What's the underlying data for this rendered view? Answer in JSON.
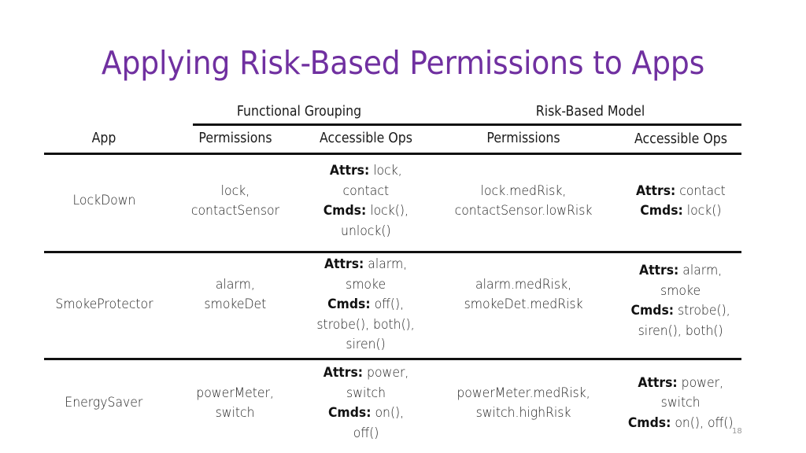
{
  "slide": {
    "title": "Applying Risk-Based Permissions to Apps",
    "page_number": "18",
    "title_color": "#7030a0"
  },
  "table": {
    "group_headers": {
      "functional": "Functional Grouping",
      "risk": "Risk-Based Model"
    },
    "columns": {
      "app": "App",
      "fg_permissions": "Permissions",
      "fg_ops": "Accessible Ops",
      "rb_permissions": "Permissions",
      "rb_ops": "Accessible Ops"
    },
    "rows": [
      {
        "app": "LockDown",
        "fg_permissions": [
          "lock,",
          "contactSensor"
        ],
        "fg_ops": {
          "attrs_label": "Attrs:",
          "attrs_lines": [
            "lock,",
            "contact"
          ],
          "cmds_label": "Cmds:",
          "cmds_lines": [
            "lock(),",
            "unlock()"
          ]
        },
        "rb_permissions": [
          "lock.medRisk,",
          "contactSensor.lowRisk"
        ],
        "rb_ops": {
          "attrs_label": "Attrs:",
          "attrs_lines": [
            "contact"
          ],
          "cmds_label": "Cmds:",
          "cmds_lines": [
            "lock()"
          ]
        }
      },
      {
        "app": "SmokeProtector",
        "fg_permissions": [
          "alarm,",
          "smokeDet"
        ],
        "fg_ops": {
          "attrs_label": "Attrs:",
          "attrs_lines": [
            "alarm,",
            "smoke"
          ],
          "cmds_label": "Cmds:",
          "cmds_lines": [
            "off(),",
            "strobe(), both(),",
            "siren()"
          ]
        },
        "rb_permissions": [
          "alarm.medRisk,",
          "smokeDet.medRisk"
        ],
        "rb_ops": {
          "attrs_label": "Attrs:",
          "attrs_lines": [
            "alarm,",
            "smoke"
          ],
          "cmds_label": "Cmds:",
          "cmds_lines": [
            "strobe(),",
            "siren(), both()"
          ]
        }
      },
      {
        "app": "EnergySaver",
        "fg_permissions": [
          "powerMeter,",
          "switch"
        ],
        "fg_ops": {
          "attrs_label": "Attrs:",
          "attrs_lines": [
            "power,",
            "switch"
          ],
          "cmds_label": "Cmds:",
          "cmds_lines": [
            "on(),",
            "off()"
          ]
        },
        "rb_permissions": [
          "powerMeter.medRisk,",
          "switch.highRisk"
        ],
        "rb_ops": {
          "attrs_label": "Attrs:",
          "attrs_lines": [
            "power,",
            "switch"
          ],
          "cmds_label": "Cmds:",
          "cmds_lines": [
            "on(), off()"
          ]
        }
      }
    ]
  }
}
